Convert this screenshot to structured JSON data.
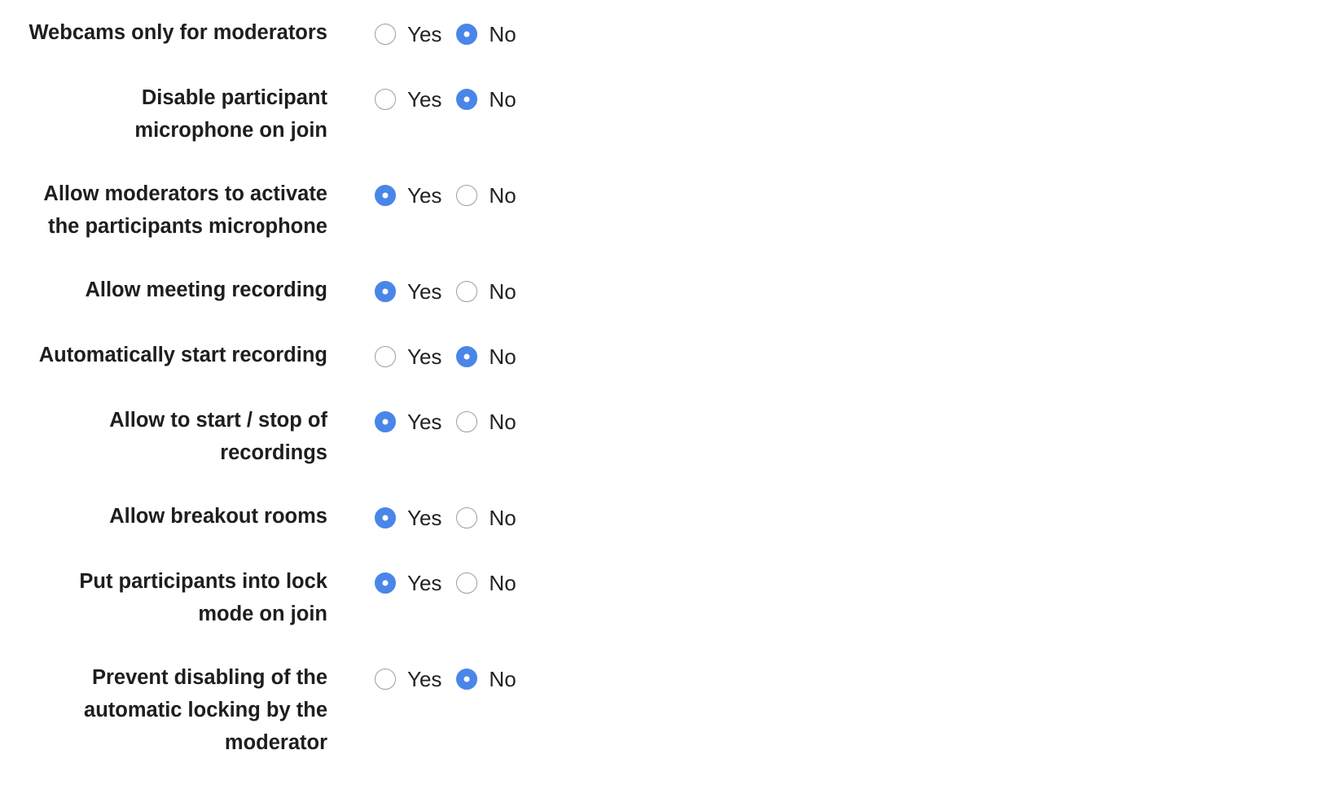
{
  "settings": [
    {
      "label": "Webcams only for moderators",
      "yes": "Yes",
      "no": "No",
      "value": "No"
    },
    {
      "label": "Disable participant microphone on join",
      "yes": "Yes",
      "no": "No",
      "value": "No"
    },
    {
      "label": "Allow moderators to activate the participants microphone",
      "yes": "Yes",
      "no": "No",
      "value": "Yes"
    },
    {
      "label": "Allow meeting recording",
      "yes": "Yes",
      "no": "No",
      "value": "Yes"
    },
    {
      "label": "Automatically start recording",
      "yes": "Yes",
      "no": "No",
      "value": "No"
    },
    {
      "label": "Allow to start / stop of recordings",
      "yes": "Yes",
      "no": "No",
      "value": "Yes"
    },
    {
      "label": "Allow breakout rooms",
      "yes": "Yes",
      "no": "No",
      "value": "Yes"
    },
    {
      "label": "Put participants into lock mode on join",
      "yes": "Yes",
      "no": "No",
      "value": "Yes"
    },
    {
      "label": "Prevent disabling of the automatic locking by the moderator",
      "yes": "Yes",
      "no": "No",
      "value": "No"
    }
  ],
  "colors": {
    "accent": "#4a86e8",
    "label_text": "#1e1e1e",
    "radio_border": "#9e9e9e"
  }
}
